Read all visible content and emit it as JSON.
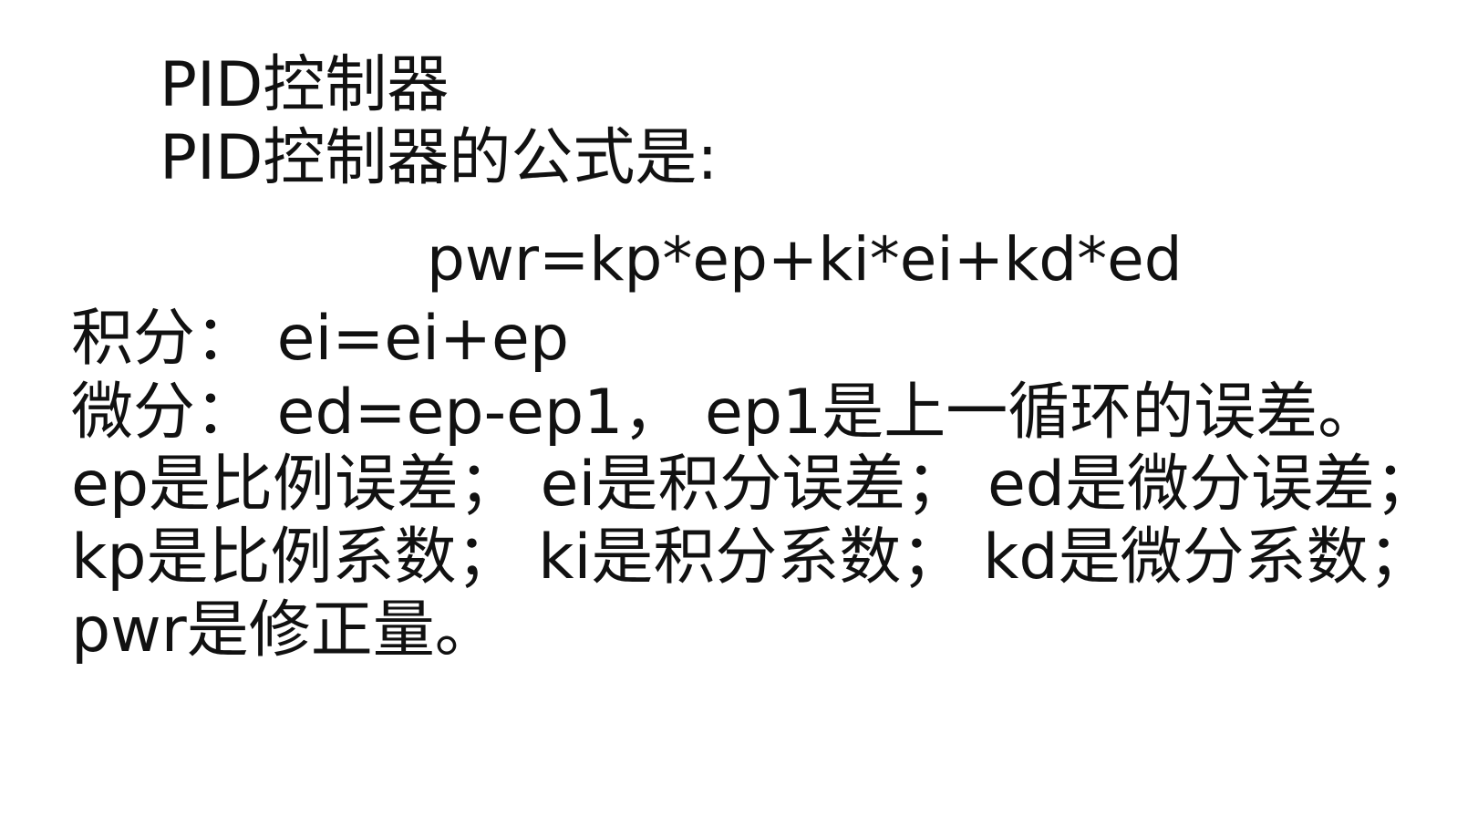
{
  "slide": {
    "title": "PID控制器",
    "subtitle": "PID控制器的公式是:",
    "formula": "pwr=kp*ep+ki*ei+kd*ed",
    "integral": "积分：  ei=ei+ep",
    "derivative": "微分：  ed=ep-ep1，  ep1是上一循环的误差。",
    "errors": "ep是比例误差；  ei是积分误差；  ed是微分误差；",
    "coefficients": "kp是比例系数；  ki是积分系数；  kd是微分系数；",
    "pwr_desc": "pwr是修正量。"
  }
}
